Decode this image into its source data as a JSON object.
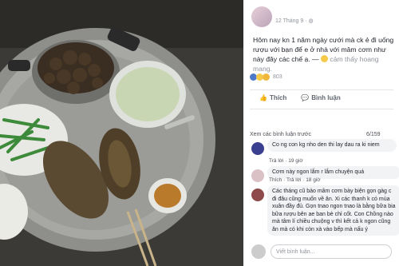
{
  "post": {
    "time": "12 Tháng 9",
    "text": "Hôm nay kn 1 năm ngày cưới mà ck ẻ đi uống rượu với bạn để e ở nhà với mâm cơm như này đây các chế ạ. —",
    "feeling": "cảm thấy hoang mang."
  },
  "reactions": {
    "count": "803"
  },
  "actions": {
    "like": "Thích",
    "comment": "Bình luận"
  },
  "comments": {
    "more_link": "Xem các bình luận trước",
    "pager": "6/159",
    "items": [
      {
        "text": "Co ng con kg nho den thi lay dau ra ki niem",
        "reply": "Trả lời",
        "ago": "19 giờ"
      },
      {
        "text": "Cơm này ngon lắm r lắm chuyện quá",
        "like": "Thích",
        "reply": "Trả lời",
        "ago": "18 giờ"
      },
      {
        "text": "Các tháng cũ bảo mâm cơm bày biện gọn gàg c đi đâu cũng muốn về ăn. Xi các thanh k có mùa xuân đầy đủ. Gọn tnao ngon tnao là bằng bữa bia bữa rượu bên ae ban bè chỉ cốt. Con Chồng nào mà tâm lí chiều chuộng v thì kết cả k ngon cũng ăn mà có khi còn xà vào bếp mà nấu ý"
      }
    ]
  },
  "composer": {
    "placeholder": "Viết bình luận..."
  }
}
